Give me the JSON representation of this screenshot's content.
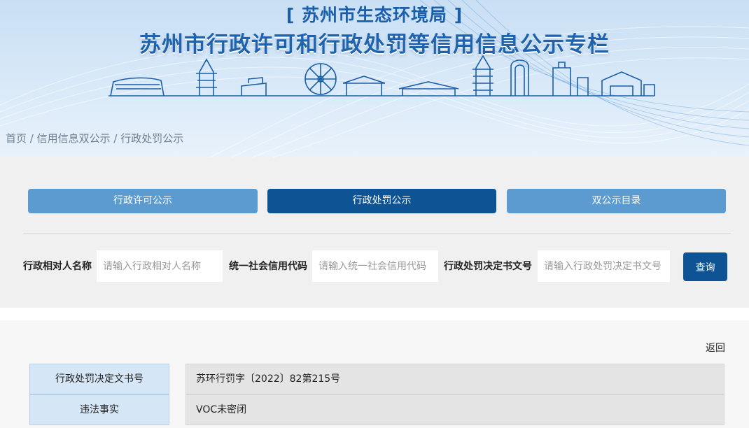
{
  "header": {
    "org_title": "[ 苏州市生态环境局 ]",
    "main_title": "苏州市行政许可和行政处罚等信用信息公示专栏"
  },
  "breadcrumb": {
    "home": "首页",
    "separator": " / ",
    "level1": "信用信息双公示",
    "level2": "行政处罚公示"
  },
  "tabs": [
    {
      "label": "行政许可公示",
      "active": false
    },
    {
      "label": "行政处罚公示",
      "active": true
    },
    {
      "label": "双公示目录",
      "active": false
    }
  ],
  "search": {
    "fields": [
      {
        "label": "行政相对人名称",
        "placeholder": "请输入行政相对人名称",
        "value": ""
      },
      {
        "label": "统一社会信用代码",
        "placeholder": "请输入统一社会信用代码",
        "value": ""
      },
      {
        "label": "行政处罚决定书文号",
        "placeholder": "请输入行政处罚决定书文号",
        "value": ""
      }
    ],
    "button_label": "查询"
  },
  "detail": {
    "back_label": "返回",
    "rows": [
      {
        "label": "行政处罚决定文书号",
        "value": "苏环行罚字〔2022〕82第215号"
      },
      {
        "label": "违法事实",
        "value": "VOC未密闭"
      }
    ]
  },
  "colors": {
    "primary": "#0e5394",
    "tab_inactive": "#5b9bd0",
    "title_blue": "#1f63ac",
    "label_cell": "#d5e6f6",
    "value_cell": "#e4e4e4"
  }
}
